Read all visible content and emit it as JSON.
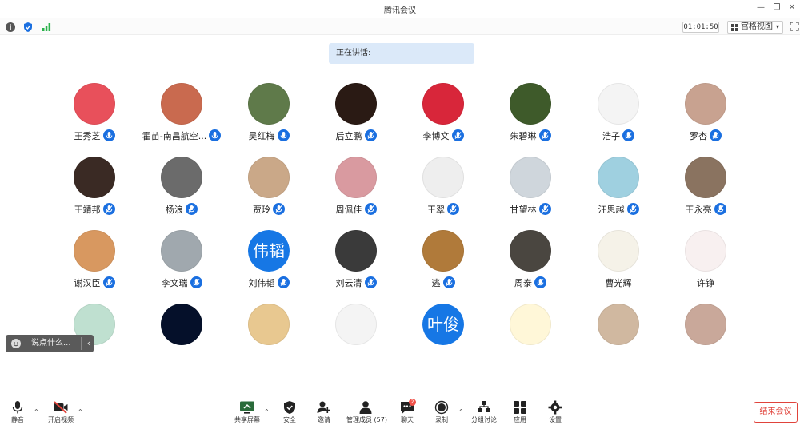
{
  "window": {
    "title": "腾讯会议"
  },
  "infobar": {
    "timer": "01:01:50",
    "view_label": "宫格视图"
  },
  "speaking": {
    "label": "正在讲话:"
  },
  "participants": [
    {
      "name": "王秀芝",
      "bg": "#e8505b",
      "muted": false
    },
    {
      "name": "霍苗-南昌航空...",
      "bg": "#c96a4f",
      "muted": false
    },
    {
      "name": "吴红梅",
      "bg": "#5f7a4a",
      "muted": false
    },
    {
      "name": "后立鹏",
      "bg": "#2a1a14",
      "muted": true
    },
    {
      "name": "李博文",
      "bg": "#d8263a",
      "muted": true
    },
    {
      "name": "朱碧琳",
      "bg": "#3e5a2a",
      "muted": true
    },
    {
      "name": "浩子",
      "bg": "#f4f4f4",
      "muted": true
    },
    {
      "name": "罗杏",
      "bg": "#c8a290",
      "muted": true
    },
    {
      "name": "王靖邦",
      "bg": "#3a2a24",
      "muted": true
    },
    {
      "name": "杨浪",
      "bg": "#6b6b6b",
      "muted": true
    },
    {
      "name": "贾玲",
      "bg": "#caa888",
      "muted": true
    },
    {
      "name": "周佩佳",
      "bg": "#d99aa0",
      "muted": true
    },
    {
      "name": "王翠",
      "bg": "#eeeeee",
      "muted": true
    },
    {
      "name": "甘望林",
      "bg": "#cfd6dc",
      "muted": true
    },
    {
      "name": "汪思越",
      "bg": "#9fd0e0",
      "muted": true
    },
    {
      "name": "王永亮",
      "bg": "#8a7360",
      "muted": true
    },
    {
      "name": "谢汉臣",
      "bg": "#d89860",
      "muted": true
    },
    {
      "name": "李文瑞",
      "bg": "#a0a8ae",
      "muted": true
    },
    {
      "name": "刘伟韬",
      "bg": "#1677e5",
      "muted": true,
      "initials": "伟韬"
    },
    {
      "name": "刘云清",
      "bg": "#3a3a3a",
      "muted": true
    },
    {
      "name": "逃",
      "bg": "#b07a3a",
      "muted": true
    },
    {
      "name": "周泰",
      "bg": "#4a4640",
      "muted": true
    },
    {
      "name": "曹光辉",
      "bg": "#f5f2e8",
      "muted": null
    },
    {
      "name": "许铮",
      "bg": "#f8f0f0",
      "muted": null
    },
    {
      "name": "",
      "bg": "#bfe0d0",
      "muted": null
    },
    {
      "name": "",
      "bg": "#05102a",
      "muted": null
    },
    {
      "name": "",
      "bg": "#e8c890",
      "muted": null
    },
    {
      "name": "",
      "bg": "#f4f4f4",
      "muted": null
    },
    {
      "name": "",
      "bg": "#1677e5",
      "muted": null,
      "initials": "叶俊"
    },
    {
      "name": "",
      "bg": "#fff7d8",
      "muted": null
    },
    {
      "name": "",
      "bg": "#d0b8a0",
      "muted": null
    },
    {
      "name": "",
      "bg": "#c9a89a",
      "muted": null
    }
  ],
  "chat_popup": {
    "placeholder": "说点什么...",
    "collapse": "‹"
  },
  "toolbar": {
    "mute": "静音",
    "video": "开启视频",
    "share": "共享屏幕",
    "security": "安全",
    "invite": "邀请",
    "members": "管理成员 (57)",
    "chat": "聊天",
    "chat_badge": "2",
    "record": "录制",
    "breakout": "分组讨论",
    "apps": "应用",
    "settings": "设置",
    "end": "结束会议"
  },
  "colors": {
    "accent": "#1a6fe0",
    "end": "#e0433b",
    "speaking_bg": "#dbe9f9"
  }
}
